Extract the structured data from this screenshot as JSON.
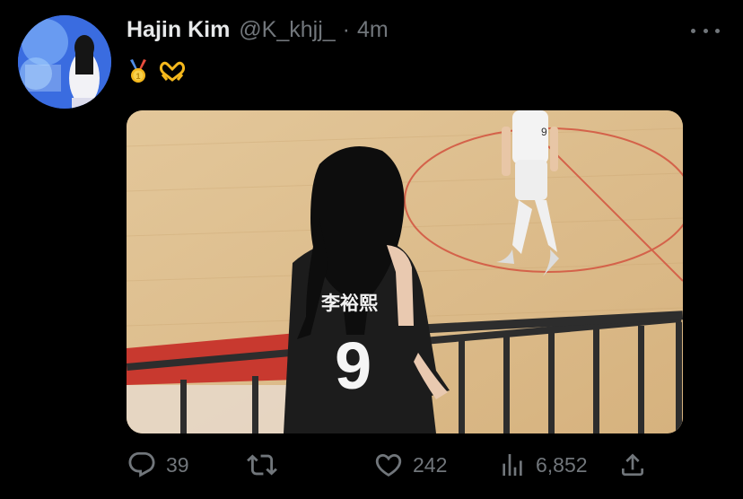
{
  "tweet": {
    "author_name": "Hajin Kim",
    "author_handle": "@K_khjj_",
    "separator": "·",
    "time": "4m",
    "text_emojis": [
      "medal-icon",
      "heart-hands-icon"
    ],
    "media": {
      "jersey_name": "李裕熙",
      "jersey_number": "9",
      "player_number": "9"
    }
  },
  "actions": {
    "replies": "39",
    "retweets": "",
    "likes": "242",
    "views": "6,852"
  },
  "icons": {
    "reply": "reply-icon",
    "retweet": "retweet-icon",
    "like": "heart-icon",
    "views": "views-icon",
    "share": "share-icon",
    "more": "more-icon"
  },
  "colors": {
    "background": "#000000",
    "text": "#e7e9ea",
    "secondary": "#71767b"
  }
}
